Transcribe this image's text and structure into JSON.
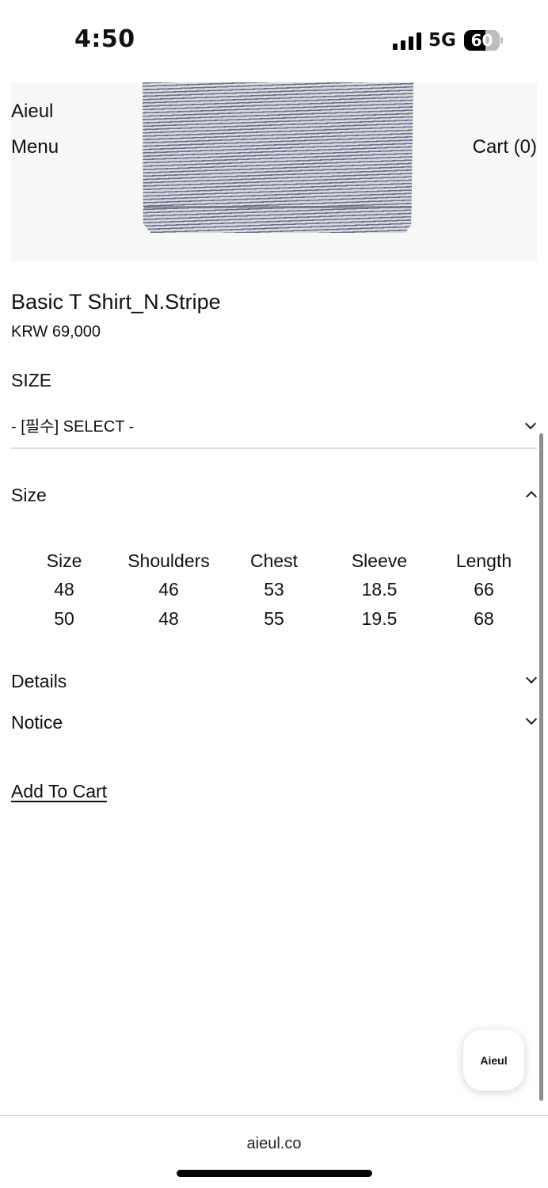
{
  "status_bar": {
    "time": "4:50",
    "network": "5G",
    "battery_level": "60",
    "battery_fraction": 0.6
  },
  "header": {
    "brand": "Aieul",
    "menu_label": "Menu",
    "cart_label": "Cart (0)"
  },
  "product": {
    "title": "Basic T Shirt_N.Stripe",
    "price": "KRW 69,000",
    "option_label": "SIZE",
    "option_selected": "- [필수] SELECT -"
  },
  "size_section": {
    "title": "Size",
    "expanded": true,
    "columns": [
      "Size",
      "Shoulders",
      "Chest",
      "Sleeve",
      "Length"
    ],
    "rows": [
      [
        "48",
        "46",
        "53",
        "18.5",
        "66"
      ],
      [
        "50",
        "48",
        "55",
        "19.5",
        "68"
      ]
    ]
  },
  "details_section": {
    "title": "Details",
    "expanded": false
  },
  "notice_section": {
    "title": "Notice",
    "expanded": false
  },
  "actions": {
    "add_to_cart": "Add To Cart"
  },
  "chat_widget": {
    "label": "Aieul"
  },
  "browser": {
    "url": "aieul.co"
  },
  "icons": {
    "signal": "cellular-signal-icon",
    "battery": "battery-icon",
    "select_chevron": "chevron-down-icon",
    "size_chevron": "chevron-up-icon",
    "details_chevron": "chevron-down-icon",
    "notice_chevron": "chevron-down-icon"
  }
}
